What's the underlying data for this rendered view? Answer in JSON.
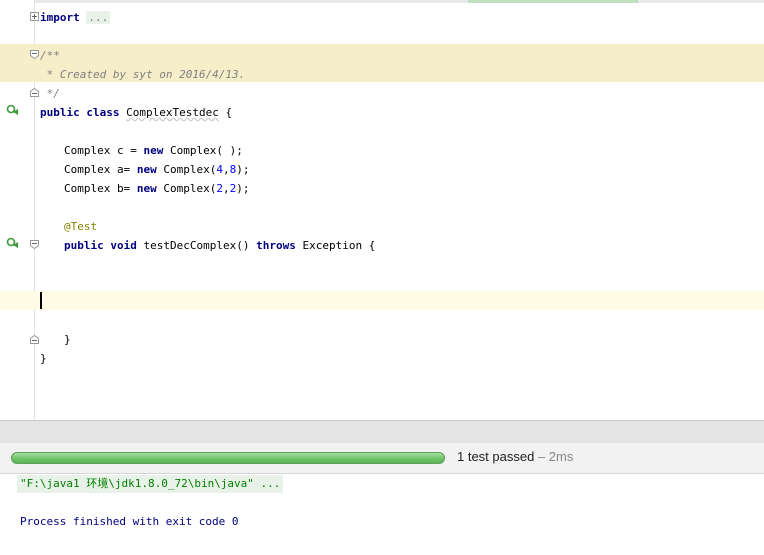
{
  "editor": {
    "import_kw": "import",
    "import_fold": "...",
    "doc_open": "/**",
    "doc_body": " * Created by syt on 2016/4/13.",
    "doc_close": " */",
    "class_kw1": "public",
    "class_kw2": "class",
    "class_name": "ComplexTestdec",
    "class_brace": " {",
    "line_c_pre": "Complex c = ",
    "line_c_new": "new",
    "line_c_post": " Complex( );",
    "line_a_pre": "Complex a= ",
    "line_a_new": "new",
    "line_a_mid": " Complex(",
    "line_a_n1": "4",
    "line_a_comma": ",",
    "line_a_n2": "8",
    "line_a_end": ");",
    "line_b_pre": "Complex b= ",
    "line_b_new": "new",
    "line_b_mid": " Complex(",
    "line_b_n1": "2",
    "line_b_comma": ",",
    "line_b_n2": "2",
    "line_b_end": ");",
    "annotation": "@Test",
    "method_kw1": "public",
    "method_kw2": "void",
    "method_name": " testDecComplex() ",
    "method_kw3": "throws",
    "method_rest": " Exception {",
    "method_close": "}",
    "class_close": "}"
  },
  "run": {
    "progress_fraction": 1.0,
    "status": "1 test passed",
    "duration": " – 2ms"
  },
  "console": {
    "command": "\"F:\\java1 环境\\jdk1.8.0_72\\bin\\java\" ...",
    "finish": "Process finished with exit code 0"
  },
  "colors": {
    "keyword": "#000080",
    "number": "#0000ff",
    "annotation": "#808000",
    "comment": "#808080",
    "progress": "#6cc364",
    "doc_highlight": "#f6edc9",
    "caret_line": "#fffbe5"
  },
  "icons": [
    "fold-expand-icon",
    "fold-collapse-icon",
    "run-test-icon"
  ]
}
